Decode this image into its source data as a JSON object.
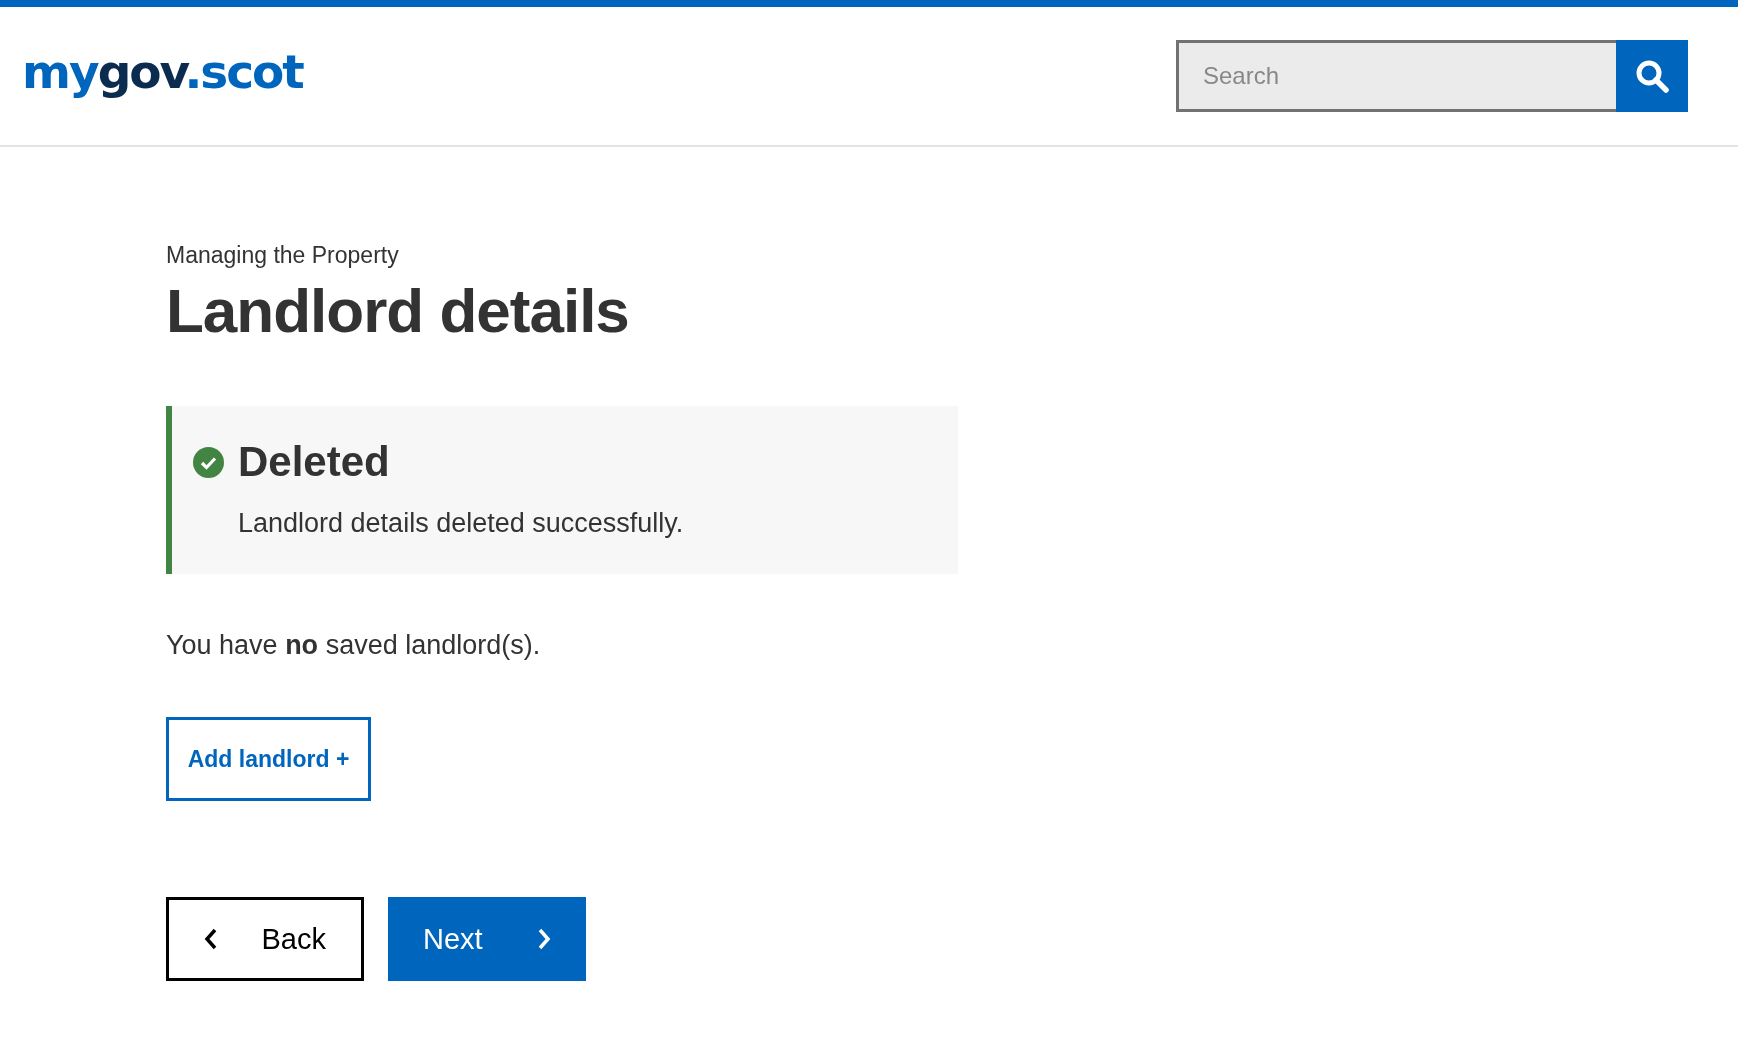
{
  "header": {
    "logo": [
      {
        "text": "my",
        "kind": "accent"
      },
      {
        "text": "gov",
        "kind": "dark"
      },
      {
        "text": ".scot",
        "kind": "accent"
      }
    ],
    "search": {
      "placeholder": "Search"
    }
  },
  "page": {
    "section": "Managing the Property",
    "title": "Landlord details"
  },
  "notification": {
    "kind": "success",
    "title": "Deleted",
    "message": "Landlord details deleted successfully."
  },
  "summary": "You have **no** saved landlord(s).",
  "add_button": "Add landlord +",
  "nav_buttons": [
    {
      "label": "Back",
      "kind": "back"
    },
    {
      "label": "Next",
      "kind": "next"
    }
  ]
}
